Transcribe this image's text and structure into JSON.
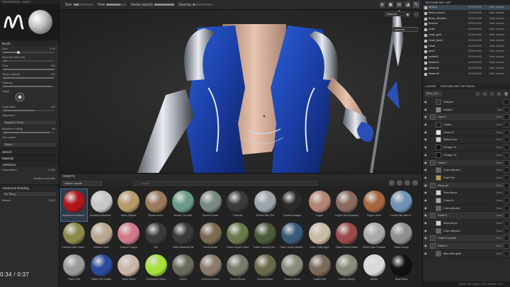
{
  "topbar": {
    "size_label": "Size",
    "size_value": 25,
    "flow_label": "Flow",
    "flow_value": 70,
    "stroke_opacity_label": "Stroke opacity",
    "stroke_opacity_value": 100,
    "spacing_label": "Spacing",
    "spacing_value": 10,
    "tools": [
      "paint-icon",
      "fill-icon",
      "smudge-icon",
      "clone-icon",
      "picker-icon"
    ]
  },
  "left_panel": {
    "header": "PROPERTIES - PAINT",
    "size_label": "Size",
    "size_value": "0.00",
    "size_fraction": 0.3,
    "min_size_label": "Minimum Size (%)",
    "min_size_value": "",
    "flow_label": "Flow",
    "flow_value": "100",
    "flow_fraction": 1.0,
    "opacity_label": "Stroke opacity",
    "opacity_value": "100",
    "opacity_fraction": 0.98,
    "spacing_label": "Spacing",
    "spacing_fraction": 0.95,
    "angle_label": "Angle",
    "jitter_label": "Angle jitter",
    "jitter_value": "100",
    "alignment_label": "Alignment",
    "alignment_value": "Tangent | Wrap",
    "backface_label": "Backface culling",
    "backface_value": "90",
    "size_space_label": "Size space",
    "size_space_value": "Object",
    "stencil_label": "Stencil",
    "material_label": "Material",
    "attributes_label": "Attributes",
    "parameters_label": "Parameters",
    "parameters_value": "1.000",
    "realtime_label": "Realtime defaults",
    "advanced_label": "Advanced Shading",
    "tiling_label": "No Tiling",
    "bleach_label": "Bleach",
    "bleach_value": "1.000",
    "video_time": "0:34 / 0:37"
  },
  "viewport": {
    "material_mode": "Material",
    "channel_option": "Material",
    "tools": [
      "camera-icon",
      "light-icon",
      "environment-icon",
      "screenshot-icon",
      "display-icon"
    ]
  },
  "shelf": {
    "title": "ASSETS",
    "filter": "Starter assets",
    "search_placeholder": "Search",
    "materials": [
      {
        "name": "Aluminium Anodized...",
        "color": "#b3161a",
        "selected": true
      },
      {
        "name": "Aluminium Brushed...",
        "color": "#c7c7c7"
      },
      {
        "name": "Brass Stylized",
        "color": "#b79a6a"
      },
      {
        "name": "Bronze Armor",
        "color": "#9b7a5a"
      },
      {
        "name": "Bronze Corroded",
        "color": "#6a9a86"
      },
      {
        "name": "Bronze Roman",
        "color": "#7a8a80"
      },
      {
        "name": "Charcoal",
        "color": "#3a3a3a"
      },
      {
        "name": "Chrome Blue Tint",
        "color": "#9aa3a9"
      },
      {
        "name": "Cobalt Damaged",
        "color": "#2a2a2a"
      },
      {
        "name": "Copper",
        "color": "#b38572"
      },
      {
        "name": "Copper Red Bleached",
        "color": "#8a6a5e"
      },
      {
        "name": "Copper Worn",
        "color": "#a6653e"
      },
      {
        "name": "Coated Silk Alien B...",
        "color": "#6f92b4"
      },
      {
        "name": "Creature Skin Green...",
        "color": "#8a8a4a"
      },
      {
        "name": "Creature Teeth",
        "color": "#b9a68e"
      },
      {
        "name": "Creature Tongue",
        "color": "#d07a8a"
      },
      {
        "name": "Dirt",
        "color": "#3b3b3b"
      },
      {
        "name": "Fabric Baseball Hat",
        "color": "#3a3a3a"
      },
      {
        "name": "Fabric Burlap",
        "color": "#7a6a52"
      },
      {
        "name": "Fabric Carpet Cubed",
        "color": "#6a7a4a"
      },
      {
        "name": "Fabric Corduroy Re...",
        "color": "#4a5a3a"
      },
      {
        "name": "Fabric Denim Marina...",
        "color": "#3a5a7a"
      },
      {
        "name": "Fabric Fluffy Aged",
        "color": "#c9bba3"
      },
      {
        "name": "Fabric Printed Tartan",
        "color": "#9a4a4a"
      },
      {
        "name": "Fabric Linen Creased",
        "color": "#a9a9a9"
      },
      {
        "name": "Fabric Rough",
        "color": "#8f8f8f"
      },
      {
        "name": "Fabric Soft",
        "color": "#9a9a9a"
      },
      {
        "name": "Fabric Suit Vintage",
        "color": "#2a4a9a"
      },
      {
        "name": "Fabric Velvet",
        "color": "#c9b6a8"
      },
      {
        "name": "Fluorescent Yellow",
        "color": "#a6e03a"
      },
      {
        "name": "Gravel",
        "color": "#6a6a5a"
      },
      {
        "name": "Ground Cracked",
        "color": "#8a7a6a"
      },
      {
        "name": "Ground Rocks",
        "color": "#7a7a6a"
      },
      {
        "name": "Ground Mossy",
        "color": "#6a6a4a"
      },
      {
        "name": "Ground Stones",
        "color": "#8a8a7a"
      },
      {
        "name": "Leather Bull",
        "color": "#7a6a5a"
      },
      {
        "name": "Leather Rough",
        "color": "#8a8a7a"
      },
      {
        "name": "Marble",
        "color": "#d8d8d8"
      },
      {
        "name": "Metal Black",
        "color": "#111111"
      }
    ]
  },
  "right_panel": {
    "texture_title": "TEXTURE SET LIST",
    "texture_sets": [
      {
        "name": "Armor1",
        "res": "4096x4096",
        "shader": "Main shader",
        "selected": true
      },
      {
        "name": "Bikini_bottom",
        "res": "4096x4096",
        "shader": "Main shader"
      },
      {
        "name": "Body_Wrinkles",
        "res": "4096x4096",
        "shader": "Main shader"
      },
      {
        "name": "Bracket",
        "res": "4096x4096",
        "shader": "Main shader"
      },
      {
        "name": "cloak",
        "res": "4096x4096",
        "shader": "Main shader"
      },
      {
        "name": "cloak_gold",
        "res": "4096x4096",
        "shader": "Main shader"
      },
      {
        "name": "cloak_jewel",
        "res": "4096x4096",
        "shader": "Main shader"
      },
      {
        "name": "Head",
        "res": "4096x4096",
        "shader": "Main shader"
      },
      {
        "name": "jewel",
        "res": "4096x4096",
        "shader": "Main shader"
      },
      {
        "name": "lowbelt1",
        "res": "4096x4096",
        "shader": "Main shader"
      },
      {
        "name": "Mirdem1",
        "res": "4096x4096",
        "shader": "Main shader"
      },
      {
        "name": "Mirdem2",
        "res": "4096x4096",
        "shader": "Main shader"
      },
      {
        "name": "Mirdem3",
        "res": "4096x4096",
        "shader": "Main shader"
      }
    ],
    "tab_layers": "LAYERS",
    "tab_settings": "TEXTURE SET SETTINGS",
    "base_color": "Base color",
    "layers": [
      {
        "name": "Sharpen",
        "blend": "",
        "group": false,
        "thumb": "#333"
      },
      {
        "name": "sharpen",
        "blend": "Repl",
        "group": false,
        "thumb": "#888"
      },
      {
        "name": "Layer 1",
        "blend": "Norm",
        "group": true,
        "thumb": "#444"
      },
      {
        "name": "Cables",
        "blend": "Norm",
        "group": false,
        "thumb": "#222"
      },
      {
        "name": "Gears 04",
        "blend": "Norm",
        "group": false,
        "thumb": "#e9e9e9"
      },
      {
        "name": "Metal Curve",
        "blend": "Norm",
        "group": false,
        "thumb": "#cfcfcf"
      },
      {
        "name": "Fill layer 14",
        "blend": "Norm",
        "group": false,
        "thumb": "#111"
      },
      {
        "name": "Fill layer 13",
        "blend": "Norm",
        "group": false,
        "thumb": "#111"
      },
      {
        "name": "Folder 7",
        "blend": "Norm",
        "group": true,
        "thumb": "#444"
      },
      {
        "name": "Color selection",
        "blend": "Norm",
        "group": false,
        "thumb": "#666"
      },
      {
        "name": "Gold Trim",
        "blend": "Norm",
        "group": false,
        "thumb": "#b89a4a"
      },
      {
        "name": "Rimus 44",
        "blend": "Norm",
        "group": true,
        "thumb": "#444"
      },
      {
        "name": "Silver Armor",
        "blend": "Norm",
        "group": false,
        "thumb": "#d0d0d0"
      },
      {
        "name": "Cross 40",
        "blend": "Norm",
        "group": false,
        "thumb": "#aaa"
      },
      {
        "name": "Color selection",
        "blend": "Norm",
        "group": false,
        "thumb": "#666"
      },
      {
        "name": "Folder 5",
        "blend": "Norm",
        "group": true,
        "thumb": "#444"
      },
      {
        "name": "Silver Armor",
        "blend": "Norm",
        "group": false,
        "thumb": "#d0d0d0"
      },
      {
        "name": "Color selection",
        "blend": "Norm",
        "group": false,
        "thumb": "#666"
      },
      {
        "name": "Folder 3 to paint",
        "blend": "Norm",
        "group": true,
        "thumb": "#444"
      },
      {
        "name": "Folder 4",
        "blend": "Norm",
        "group": true,
        "thumb": "#444"
      },
      {
        "name": "Base dark grain",
        "blend": "Norm",
        "group": false,
        "thumb": "#5a5a5a"
      }
    ],
    "footer": "Cache Disk Usage: 77% | Version: 9.0.1"
  }
}
